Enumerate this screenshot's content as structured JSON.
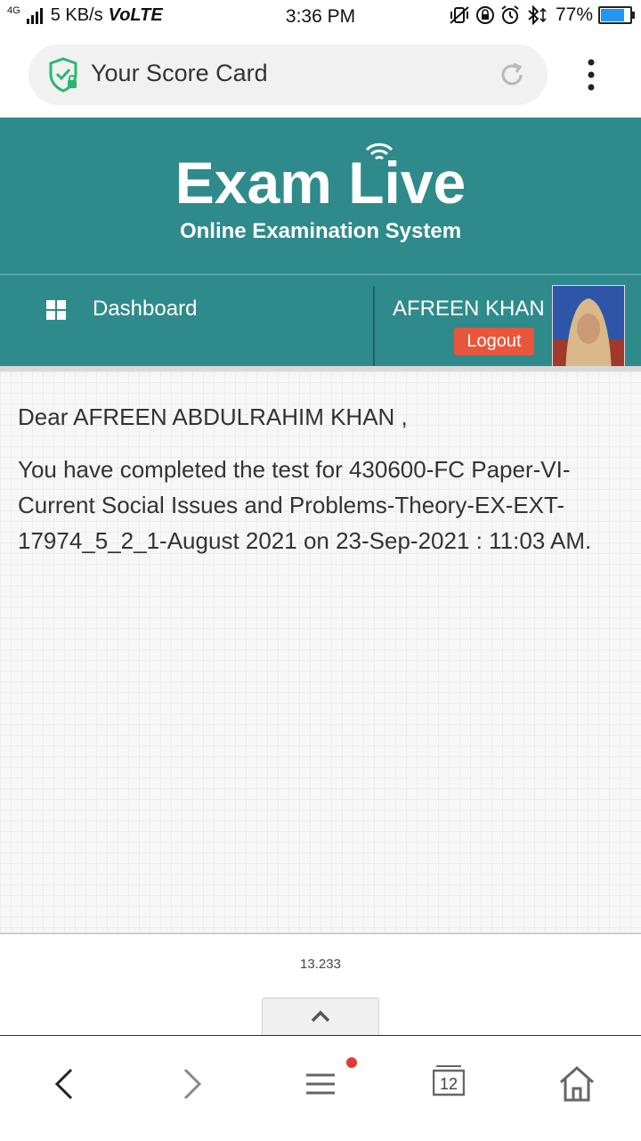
{
  "status_bar": {
    "network": "4G",
    "speed": "5 KB/s",
    "volte": "VoLTE",
    "time": "3:36 PM",
    "battery": "77%",
    "battery_level": 0.77
  },
  "browser": {
    "page_title": "Your Score Card",
    "icons": [
      "shield-lock-icon",
      "reload-icon",
      "more-vert-icon"
    ]
  },
  "site": {
    "brand": "Exam Live",
    "tagline": "Online Examination System",
    "accent": "#2f8a8c",
    "logout_color": "#e8563b"
  },
  "nav": {
    "dashboard_label": "Dashboard",
    "user_name": "AFREEN KHAN",
    "logout_label": "Logout"
  },
  "content": {
    "greeting": "Dear AFREEN ABDULRAHIM KHAN ,",
    "message": "You have completed the test for 430600-FC Paper-VI-Current Social Issues and Problems-Theory-EX-EXT-17974_5_2_1-August 2021 on 23-Sep-2021 : 11:03 AM."
  },
  "footer": {
    "version": "13.233"
  },
  "bottom_nav": {
    "tabs_count": "12",
    "icons": [
      "back-icon",
      "forward-icon",
      "menu-icon",
      "tabs-icon",
      "home-icon"
    ]
  }
}
